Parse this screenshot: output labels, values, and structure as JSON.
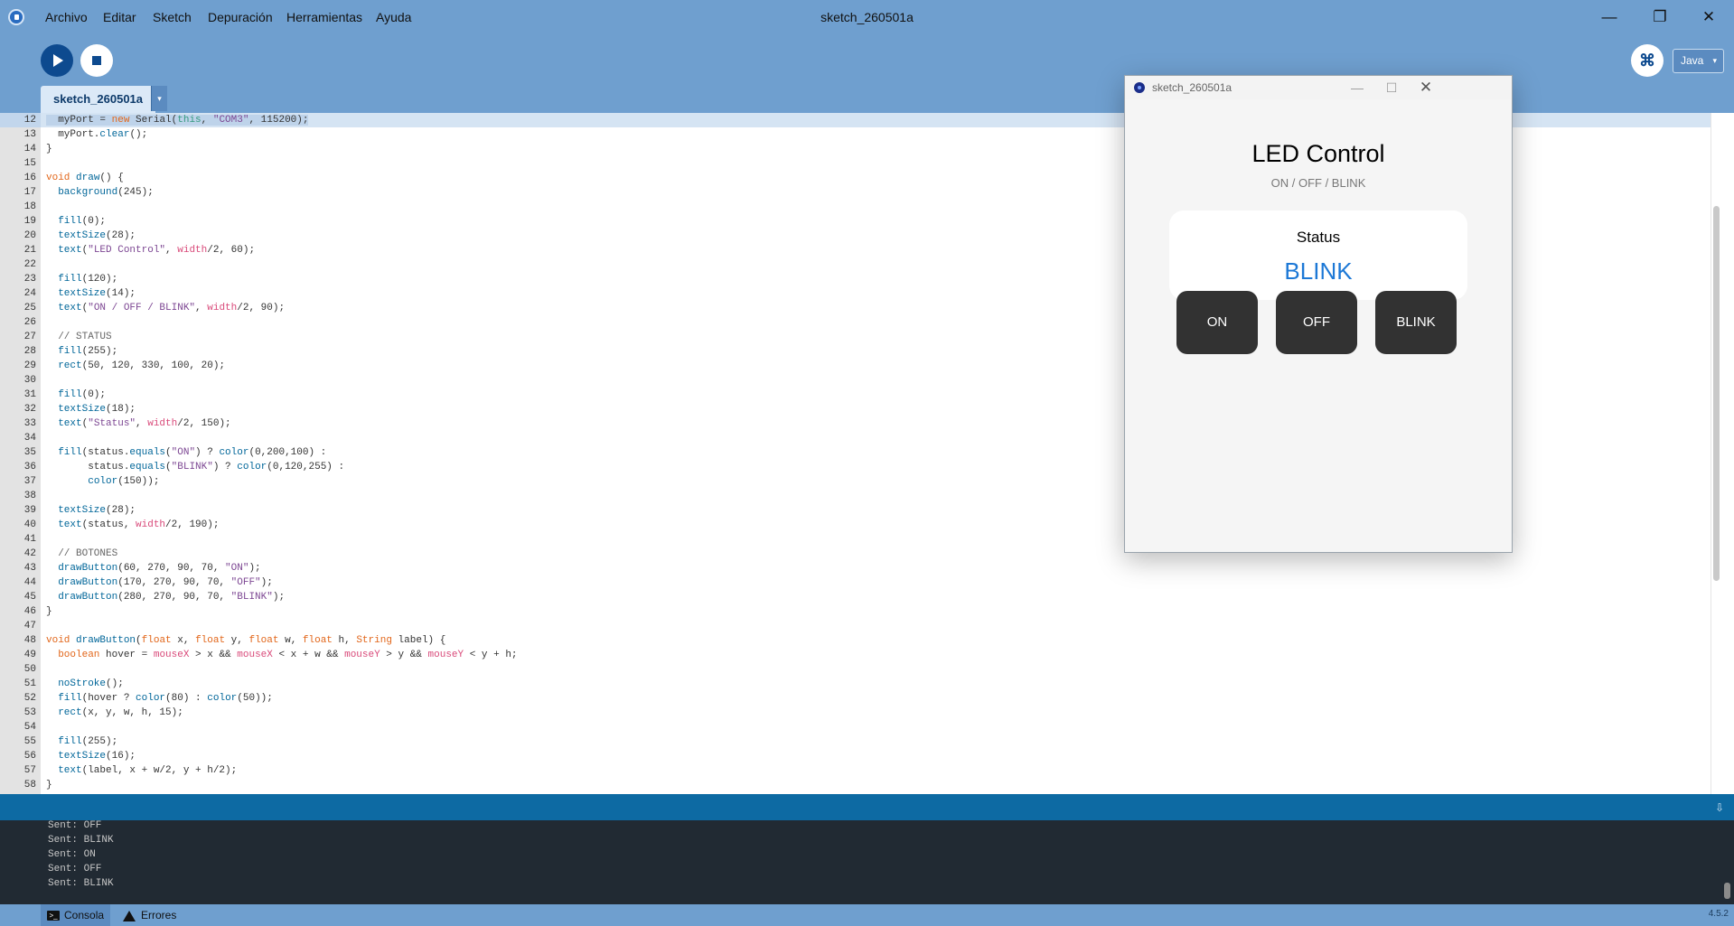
{
  "menu": {
    "items": [
      "Archivo",
      "Editar",
      "Sketch",
      "Depuración",
      "Herramientas",
      "Ayuda"
    ]
  },
  "window": {
    "title": "sketch_260501a",
    "controls": {
      "minimize": "—",
      "restore": "❐",
      "close": "✕"
    }
  },
  "toolbar": {
    "run_icon": "play-icon",
    "stop_icon": "stop-icon",
    "debug_icon": "debugger-icon",
    "debug_glyph": "⌘",
    "mode": "Java",
    "mode_arrow": "▾"
  },
  "tabs": [
    {
      "label": "sketch_260501a",
      "active": true
    }
  ],
  "tab_menu_arrow": "▾",
  "editor": {
    "current_line": 12,
    "lines": [
      {
        "n": "12",
        "code": "  myPort = new Serial(this, \"COM3\", 115200);"
      },
      {
        "n": "13",
        "code": "  myPort.clear();"
      },
      {
        "n": "14",
        "code": "}"
      },
      {
        "n": "15",
        "code": ""
      },
      {
        "n": "16",
        "code": "void draw() {"
      },
      {
        "n": "17",
        "code": "  background(245);"
      },
      {
        "n": "18",
        "code": ""
      },
      {
        "n": "19",
        "code": "  fill(0);"
      },
      {
        "n": "20",
        "code": "  textSize(28);"
      },
      {
        "n": "21",
        "code": "  text(\"LED Control\", width/2, 60);"
      },
      {
        "n": "22",
        "code": ""
      },
      {
        "n": "23",
        "code": "  fill(120);"
      },
      {
        "n": "24",
        "code": "  textSize(14);"
      },
      {
        "n": "25",
        "code": "  text(\"ON / OFF / BLINK\", width/2, 90);"
      },
      {
        "n": "26",
        "code": ""
      },
      {
        "n": "27",
        "code": "  // STATUS"
      },
      {
        "n": "28",
        "code": "  fill(255);"
      },
      {
        "n": "29",
        "code": "  rect(50, 120, 330, 100, 20);"
      },
      {
        "n": "30",
        "code": ""
      },
      {
        "n": "31",
        "code": "  fill(0);"
      },
      {
        "n": "32",
        "code": "  textSize(18);"
      },
      {
        "n": "33",
        "code": "  text(\"Status\", width/2, 150);"
      },
      {
        "n": "34",
        "code": ""
      },
      {
        "n": "35",
        "code": "  fill(status.equals(\"ON\") ? color(0,200,100) :"
      },
      {
        "n": "36",
        "code": "       status.equals(\"BLINK\") ? color(0,120,255) :"
      },
      {
        "n": "37",
        "code": "       color(150));"
      },
      {
        "n": "38",
        "code": ""
      },
      {
        "n": "39",
        "code": "  textSize(28);"
      },
      {
        "n": "40",
        "code": "  text(status, width/2, 190);"
      },
      {
        "n": "41",
        "code": ""
      },
      {
        "n": "42",
        "code": "  // BOTONES"
      },
      {
        "n": "43",
        "code": "  drawButton(60, 270, 90, 70, \"ON\");"
      },
      {
        "n": "44",
        "code": "  drawButton(170, 270, 90, 70, \"OFF\");"
      },
      {
        "n": "45",
        "code": "  drawButton(280, 270, 90, 70, \"BLINK\");"
      },
      {
        "n": "46",
        "code": "}"
      },
      {
        "n": "47",
        "code": ""
      },
      {
        "n": "48",
        "code": "void drawButton(float x, float y, float w, float h, String label) {"
      },
      {
        "n": "49",
        "code": "  boolean hover = mouseX > x && mouseX < x + w && mouseY > y && mouseY < y + h;"
      },
      {
        "n": "50",
        "code": ""
      },
      {
        "n": "51",
        "code": "  noStroke();"
      },
      {
        "n": "52",
        "code": "  fill(hover ? color(80) : color(50));"
      },
      {
        "n": "53",
        "code": "  rect(x, y, w, h, 15);"
      },
      {
        "n": "54",
        "code": ""
      },
      {
        "n": "55",
        "code": "  fill(255);"
      },
      {
        "n": "56",
        "code": "  textSize(16);"
      },
      {
        "n": "57",
        "code": "  text(label, x + w/2, y + h/2);"
      },
      {
        "n": "58",
        "code": "}"
      }
    ]
  },
  "console": {
    "scroll_glyph": "⇩",
    "lines": [
      "Sent: OFF",
      "Sent: BLINK",
      "Sent: ON",
      "Sent: OFF",
      "Sent: BLINK"
    ]
  },
  "statusbar": {
    "console_tab": "Consola",
    "errors_tab": "Errores",
    "version": "4.5.2"
  },
  "sketch_window": {
    "title": "sketch_260501a",
    "controls": {
      "minimize": "—",
      "maximize": "☐",
      "close": "✕"
    },
    "heading": "LED Control",
    "subheading": "ON / OFF / BLINK",
    "status_label": "Status",
    "status_value": "BLINK",
    "status_color": "#1c78d6",
    "buttons": [
      "ON",
      "OFF",
      "BLINK"
    ]
  },
  "colors": {
    "chrome_blue": "#6f9fcf",
    "console_header": "#0d6aa3",
    "console_bg": "#212a33",
    "run_button": "#0d4a8f"
  }
}
